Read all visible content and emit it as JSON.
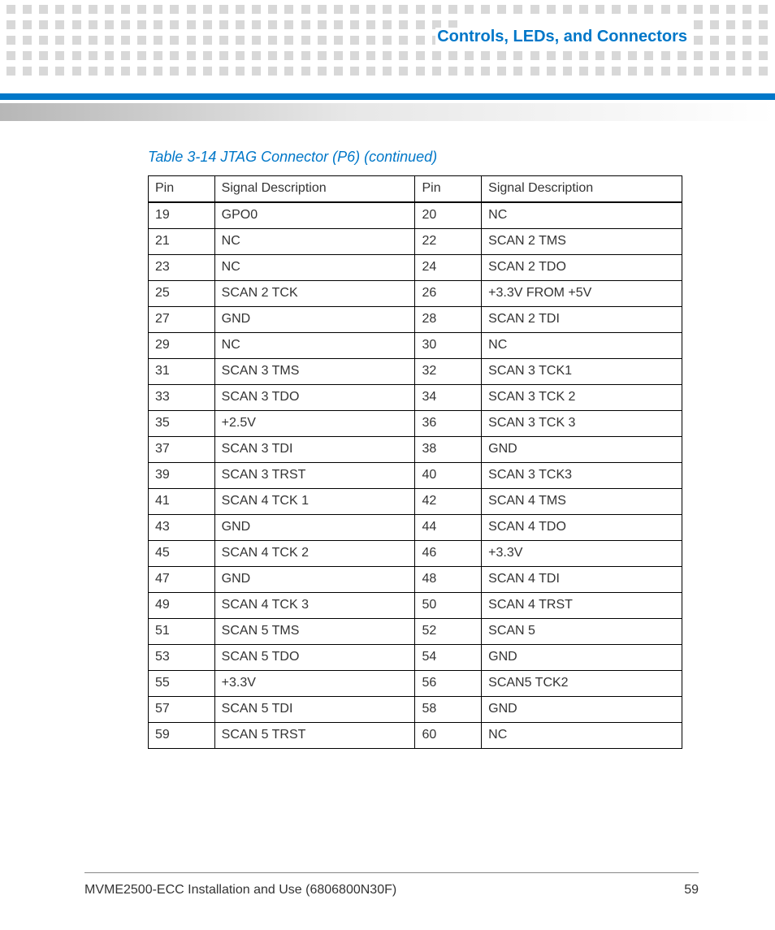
{
  "header": {
    "section_title": "Controls, LEDs, and Connectors"
  },
  "table": {
    "caption": "Table 3-14 JTAG Connector (P6)  (continued)",
    "columns": [
      "Pin",
      "Signal Description",
      "Pin",
      "Signal Description"
    ],
    "rows": [
      [
        "19",
        "GPO0",
        "20",
        "NC"
      ],
      [
        "21",
        "NC",
        "22",
        "SCAN 2 TMS"
      ],
      [
        "23",
        "NC",
        "24",
        "SCAN 2 TDO"
      ],
      [
        "25",
        "SCAN 2 TCK",
        "26",
        "+3.3V FROM +5V"
      ],
      [
        "27",
        "GND",
        "28",
        "SCAN 2 TDI"
      ],
      [
        "29",
        "NC",
        "30",
        "NC"
      ],
      [
        "31",
        "SCAN 3 TMS",
        "32",
        "SCAN 3 TCK1"
      ],
      [
        "33",
        "SCAN 3 TDO",
        "34",
        "SCAN 3 TCK 2"
      ],
      [
        "35",
        "+2.5V",
        "36",
        "SCAN 3 TCK 3"
      ],
      [
        "37",
        "SCAN 3 TDI",
        "38",
        "GND"
      ],
      [
        "39",
        "SCAN 3 TRST",
        "40",
        "SCAN 3 TCK3"
      ],
      [
        "41",
        "SCAN 4 TCK 1",
        "42",
        "SCAN 4 TMS"
      ],
      [
        "43",
        "GND",
        "44",
        "SCAN 4 TDO"
      ],
      [
        "45",
        "SCAN 4 TCK 2",
        "46",
        "+3.3V"
      ],
      [
        "47",
        "GND",
        "48",
        "SCAN 4 TDI"
      ],
      [
        "49",
        "SCAN 4 TCK 3",
        "50",
        "SCAN 4 TRST"
      ],
      [
        "51",
        "SCAN 5 TMS",
        "52",
        "SCAN 5"
      ],
      [
        "53",
        "SCAN 5 TDO",
        "54",
        "GND"
      ],
      [
        "55",
        "+3.3V",
        "56",
        "SCAN5 TCK2"
      ],
      [
        "57",
        "SCAN 5 TDI",
        "58",
        "GND"
      ],
      [
        "59",
        "SCAN 5 TRST",
        "60",
        "NC"
      ]
    ]
  },
  "footer": {
    "doc_title": "MVME2500-ECC Installation and Use (6806800N30F)",
    "page_number": "59"
  }
}
